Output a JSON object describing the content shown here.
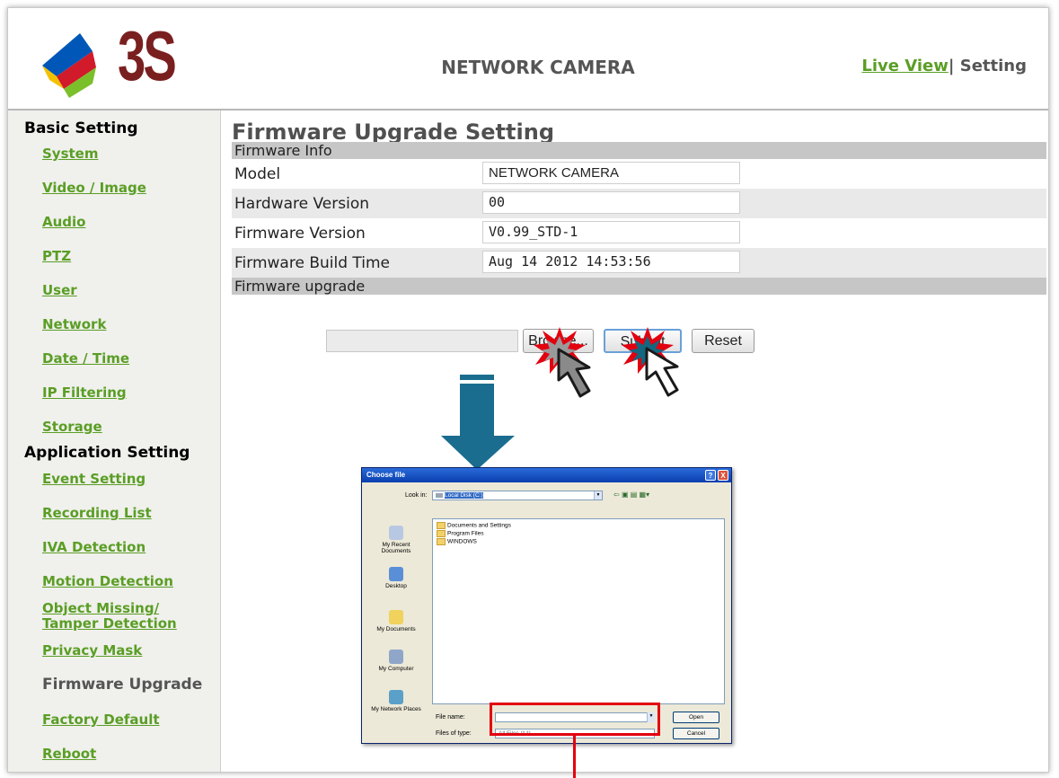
{
  "header": {
    "logo_text": "3S",
    "app_title": "NETWORK CAMERA",
    "live_view_link": "Live View",
    "separator": "|",
    "setting_label": "Setting"
  },
  "sidebar": {
    "basic_heading": "Basic Setting",
    "basic_items": [
      "System",
      "Video / Image",
      "Audio",
      "PTZ",
      "User",
      "Network",
      "Date / Time",
      "IP Filtering",
      "Storage"
    ],
    "app_heading": "Application Setting",
    "app_items": [
      "Event Setting",
      "Recording List",
      "IVA Detection",
      "Motion Detection",
      "Object Missing/",
      "Tamper Detection",
      "Privacy Mask",
      "Firmware Upgrade",
      "Factory Default",
      "Reboot"
    ],
    "current_item": "Firmware Upgrade"
  },
  "main": {
    "page_title": "Firmware Upgrade Setting",
    "info_section": "Firmware Info",
    "rows": [
      {
        "label": "Model",
        "value": "NETWORK CAMERA"
      },
      {
        "label": "Hardware Version",
        "value": "00"
      },
      {
        "label": "Firmware Version",
        "value": "V0.99_STD-1"
      },
      {
        "label": "Firmware Build Time",
        "value": "Aug 14 2012 14:53:56"
      }
    ],
    "upgrade_section": "Firmware upgrade",
    "file_input_value": "",
    "browse_label": "Browse...",
    "submit_label": "Submit",
    "reset_label": "Reset"
  },
  "dialog": {
    "title": "Choose file",
    "look_in_label": "Look in:",
    "look_in_value": "Local Disk (C:)",
    "folders": [
      "Documents and Settings",
      "Program Files",
      "WINDOWS"
    ],
    "places": [
      "My Recent Documents",
      "Desktop",
      "My Documents",
      "My Computer",
      "My Network Places"
    ],
    "file_name_label": "File name:",
    "file_name_value": "",
    "files_of_type_label": "Files of type:",
    "files_of_type_value": "All Files (*.*)",
    "open_label": "Open",
    "cancel_label": "Cancel",
    "help_symbol": "?",
    "close_symbol": "X"
  },
  "colors": {
    "link_green": "#5a9e25",
    "header_bar": "#c6c6c6",
    "arrow_blue": "#1a6d8f",
    "highlight_red": "#e3000f",
    "burst_red": "#e3000f"
  },
  "icons": {
    "down_arrow": "down-arrow-icon",
    "cursor_gray": "cursor-arrow-icon",
    "cursor_white": "cursor-arrow-icon",
    "burst": "click-burst-icon"
  }
}
